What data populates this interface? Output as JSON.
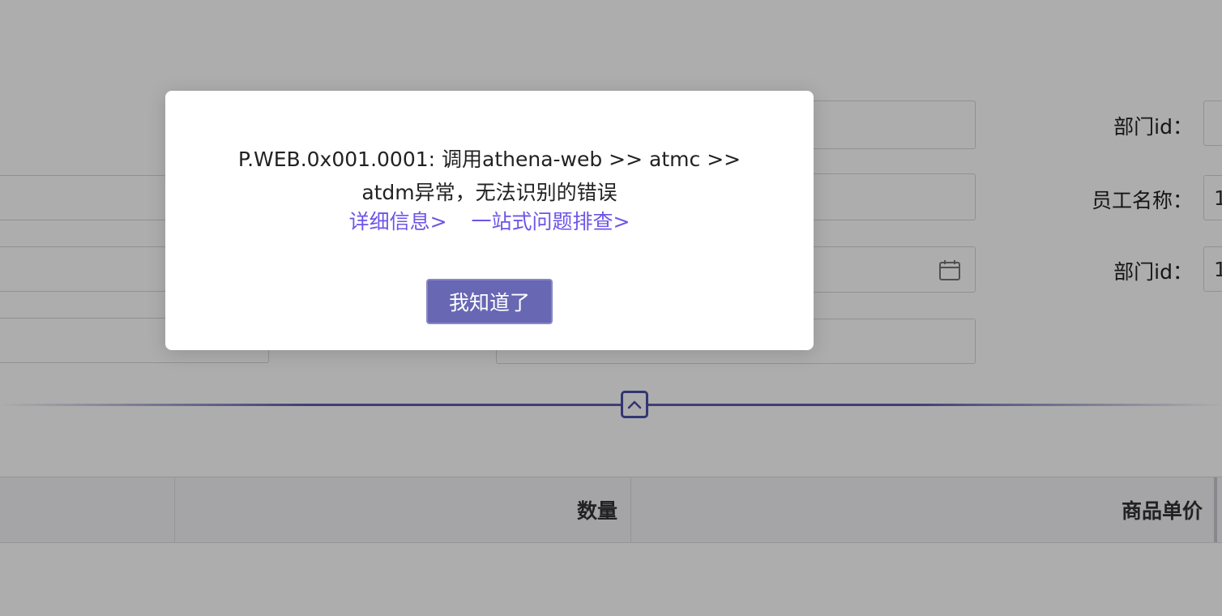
{
  "form": {
    "dept_id_label_1": "部门id：",
    "employee_name_label": "员工名称：",
    "dept_id_label_2": "部门id：",
    "dept_id_value_2": "1",
    "employee_name_value": "1"
  },
  "table": {
    "headers": [
      "数量",
      "商品单价"
    ]
  },
  "dialog": {
    "message": "P.WEB.0x001.0001: 调用athena-web >> atmc >> atdm异常，无法识别的错误",
    "detail_link": "详细信息>",
    "troubleshoot_link": "一站式问题排查>",
    "confirm_button": "我知道了"
  },
  "icons": {
    "calendar": "calendar-icon",
    "collapse": "chevron-up-icon"
  },
  "colors": {
    "accent": "#6867b4",
    "link": "#6c55e8",
    "divider": "#5d5fb0"
  }
}
